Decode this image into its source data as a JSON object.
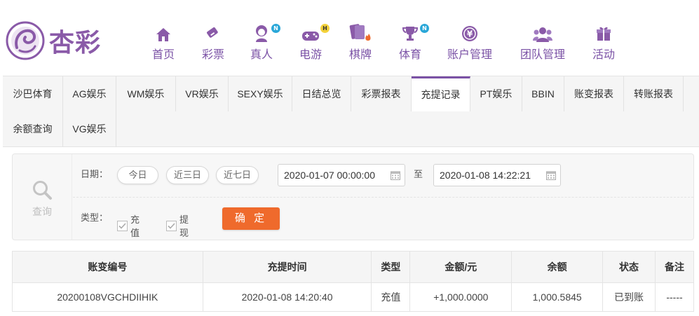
{
  "brand": {
    "name": "杏彩"
  },
  "nav": [
    {
      "label": "首页",
      "icon": "home-icon",
      "badge": ""
    },
    {
      "label": "彩票",
      "icon": "lottery-ticket-icon",
      "badge": ""
    },
    {
      "label": "真人",
      "icon": "live-dealer-icon",
      "badge": "N"
    },
    {
      "label": "电游",
      "icon": "gamepad-icon",
      "badge": "H"
    },
    {
      "label": "棋牌",
      "icon": "cards-icon",
      "badge": ""
    },
    {
      "label": "体育",
      "icon": "trophy-icon",
      "badge": "N"
    },
    {
      "label": "账户管理",
      "icon": "yen-coin-icon",
      "badge": ""
    },
    {
      "label": "团队管理",
      "icon": "team-icon",
      "badge": ""
    },
    {
      "label": "活动",
      "icon": "gift-icon",
      "badge": ""
    }
  ],
  "tabs": [
    "沙巴体育",
    "AG娱乐",
    "WM娱乐",
    "VR娱乐",
    "SEXY娱乐",
    "日结总览",
    "彩票报表",
    "充提记录",
    "PT娱乐",
    "BBIN",
    "账变报表",
    "转账报表",
    "余额查询",
    "VG娱乐"
  ],
  "active_tab": "充提记录",
  "query": {
    "side_label": "查询",
    "date_label": "日期：",
    "quick": [
      "今日",
      "近三日",
      "近七日"
    ],
    "start": "2020-01-07 00:00:00",
    "to": "至",
    "end": "2020-01-08 14:22:21",
    "type_label": "类型：",
    "types": [
      "充值",
      "提现"
    ],
    "confirm": "确 定"
  },
  "table": {
    "headers": [
      "账变编号",
      "充提时间",
      "类型",
      "金额/元",
      "余额",
      "状态",
      "备注"
    ],
    "rows": [
      [
        "20200108VGCHDIIHIK",
        "2020-01-08 14:20:40",
        "充值",
        "+1,000.0000",
        "1,000.5845",
        "已到账",
        "-----"
      ]
    ]
  },
  "colors": {
    "brand": "#7b52a6",
    "accent": "#ef6a2c",
    "amount": "#d4292e",
    "status_ok": "#3e9f33"
  }
}
